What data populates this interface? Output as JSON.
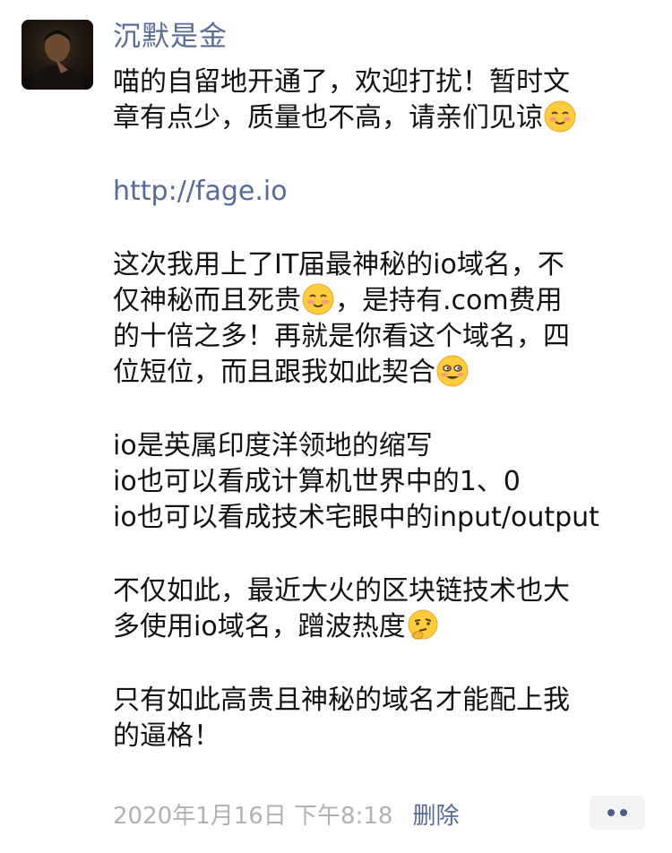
{
  "post": {
    "author_name": "沉默是金",
    "paragraph_1": {
      "line_1": "喵的自留地开通了，欢迎打扰！暂时文",
      "line_2": "章有点少，质量也不高，请亲们见谅"
    },
    "link": "http://fage.io",
    "paragraph_2": {
      "line_1": "这次我用上了IT届最神秘的io域名，不",
      "line_2a": "仅神秘而且死贵",
      "line_2b": "，是持有.com费用",
      "line_3": "的十倍之多！再就是你看这个域名，四",
      "line_4": "位短位，而且跟我如此契合"
    },
    "paragraph_3": {
      "line_1": "io是英属印度洋领地的缩写",
      "line_2": "io也可以看成计算机世界中的1、0",
      "line_3": "io也可以看成技术宅眼中的input/output"
    },
    "paragraph_4": {
      "line_1": "不仅如此，最近大火的区块链技术也大",
      "line_2": "多使用io域名，蹭波热度"
    },
    "paragraph_5": {
      "line_1": "只有如此高贵且神秘的域名才能配上我",
      "line_2": "的逼格！"
    },
    "timestamp": "2020年1月16日 下午8:18",
    "delete_label": "删除",
    "emojis": [
      "blush-emoji",
      "blush-emoji",
      "grin-emoji",
      "thinking-emoji"
    ]
  },
  "colors": {
    "name_link": "#576b95",
    "body_text": "#111111",
    "timestamp": "#b2b2b2",
    "emoji_face": "#ffcc3d"
  }
}
